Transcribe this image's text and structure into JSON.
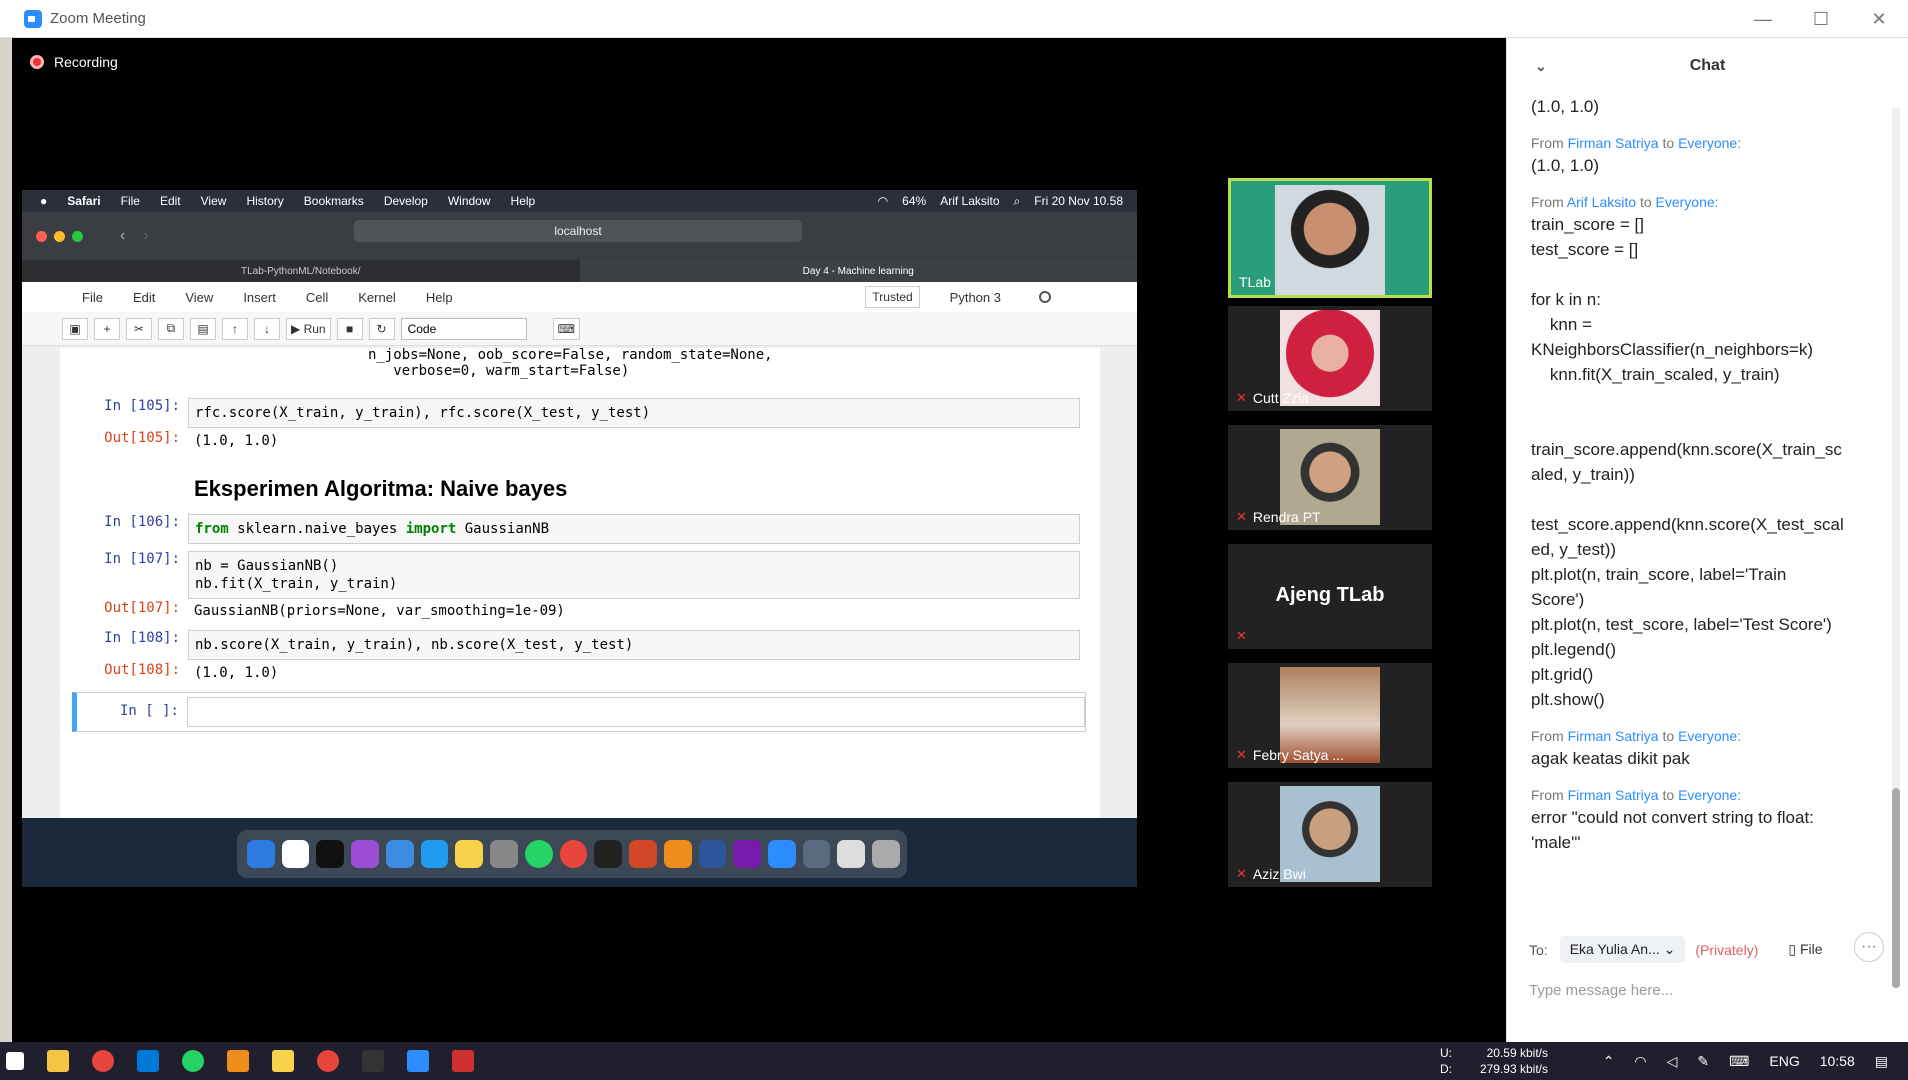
{
  "window": {
    "title": "Zoom Meeting",
    "minimize": "—",
    "maximize": "☐",
    "close": "✕"
  },
  "recording": "Recording",
  "mac": {
    "menubar": [
      "Safari",
      "File",
      "Edit",
      "View",
      "History",
      "Bookmarks",
      "Develop",
      "Window",
      "Help"
    ],
    "battery": "64%",
    "user": "Arif Laksito",
    "datetime": "Fri 20 Nov 10.58",
    "url": "localhost",
    "tabs": [
      "TLab-PythonML/Notebook/",
      "Day 4 - Machine learning"
    ]
  },
  "jupyter": {
    "menu": [
      "File",
      "Edit",
      "View",
      "Insert",
      "Cell",
      "Kernel",
      "Help"
    ],
    "trusted": "Trusted",
    "kernel": "Python 3",
    "run_label": "Run",
    "cell_type": "Code",
    "prev_output": "n_jobs=None, oob_score=False, random_state=None,\n   verbose=0, warm_start=False)",
    "cells": [
      {
        "in": "In [105]:",
        "code": "rfc.score(X_train, y_train), rfc.score(X_test, y_test)",
        "out_label": "Out[105]:",
        "out": "(1.0, 1.0)"
      },
      {
        "in": "In [106]:",
        "code_kw1": "from",
        "code_mid": " sklearn.naive_bayes ",
        "code_kw2": "import",
        "code_end": " GaussianNB"
      },
      {
        "in": "In [107]:",
        "code": "nb = GaussianNB()\nnb.fit(X_train, y_train)",
        "out_label": "Out[107]:",
        "out": "GaussianNB(priors=None, var_smoothing=1e-09)"
      },
      {
        "in": "In [108]:",
        "code": "nb.score(X_train, y_train), nb.score(X_test, y_test)",
        "out_label": "Out[108]:",
        "out": "(1.0, 1.0)"
      },
      {
        "in": "In [ ]:"
      }
    ],
    "heading": "Eksperimen Algoritma: Naive bayes"
  },
  "participants": [
    {
      "name": "TLab"
    },
    {
      "name": "Cutt Zzia"
    },
    {
      "name": "Rendra PT"
    },
    {
      "name": "Ajeng TLab"
    },
    {
      "name": "Febry Satya ..."
    },
    {
      "name": "Aziz Bwi"
    }
  ],
  "chat": {
    "title": "Chat",
    "from_word": "From",
    "to_word": "to",
    "everyone": "Everyone:",
    "first_text": "(1.0, 1.0)",
    "messages": [
      {
        "sender": "Firman Satriya",
        "text": "(1.0, 1.0)"
      },
      {
        "sender": "Arif Laksito",
        "text": "train_score = []\ntest_score = []\n\nfor k in n:\n    knn =\nKNeighborsClassifier(n_neighbors=k)\n    knn.fit(X_train_scaled, y_train)\n\n\ntrain_score.append(knn.score(X_train_sc\naled, y_train))\n\ntest_score.append(knn.score(X_test_scal\ned, y_test))\nplt.plot(n, train_score, label='Train\nScore')\nplt.plot(n, test_score, label='Test Score')\nplt.legend()\nplt.grid()\nplt.show()"
      },
      {
        "sender": "Firman Satriya",
        "text": "agak keatas dikit pak"
      },
      {
        "sender": "Firman Satriya",
        "text": "error \"could not convert string to float:\n'male'\""
      }
    ],
    "to_label": "To:",
    "recipient": "Eka Yulia An...",
    "privately": "(Privately)",
    "file": "File",
    "placeholder": "Type message here..."
  },
  "taskbar": {
    "up_label": "U:",
    "down_label": "D:",
    "upload": "20.59 kbit/s",
    "download": "279.93 kbit/s",
    "lang": "ENG",
    "time": "10:58"
  }
}
